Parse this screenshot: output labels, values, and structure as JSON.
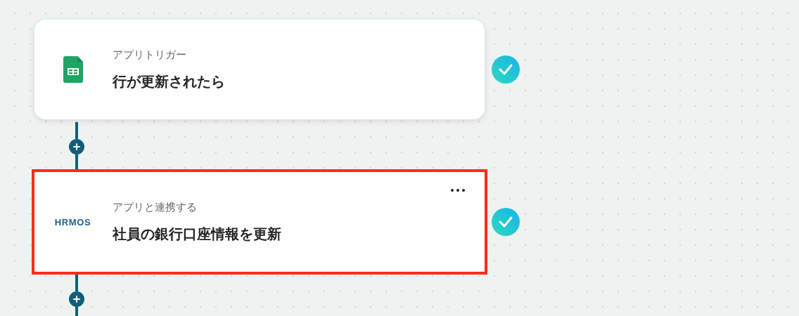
{
  "steps": [
    {
      "kind": "sheets",
      "label": "アプリトリガー",
      "title": "行が更新されたら",
      "highlighted": false,
      "done": true,
      "menu": false
    },
    {
      "kind": "hrmos",
      "logo_text": "HRMOS",
      "label": "アプリと連携する",
      "title": "社員の銀行口座情報を更新",
      "highlighted": true,
      "done": true,
      "menu": true
    }
  ]
}
